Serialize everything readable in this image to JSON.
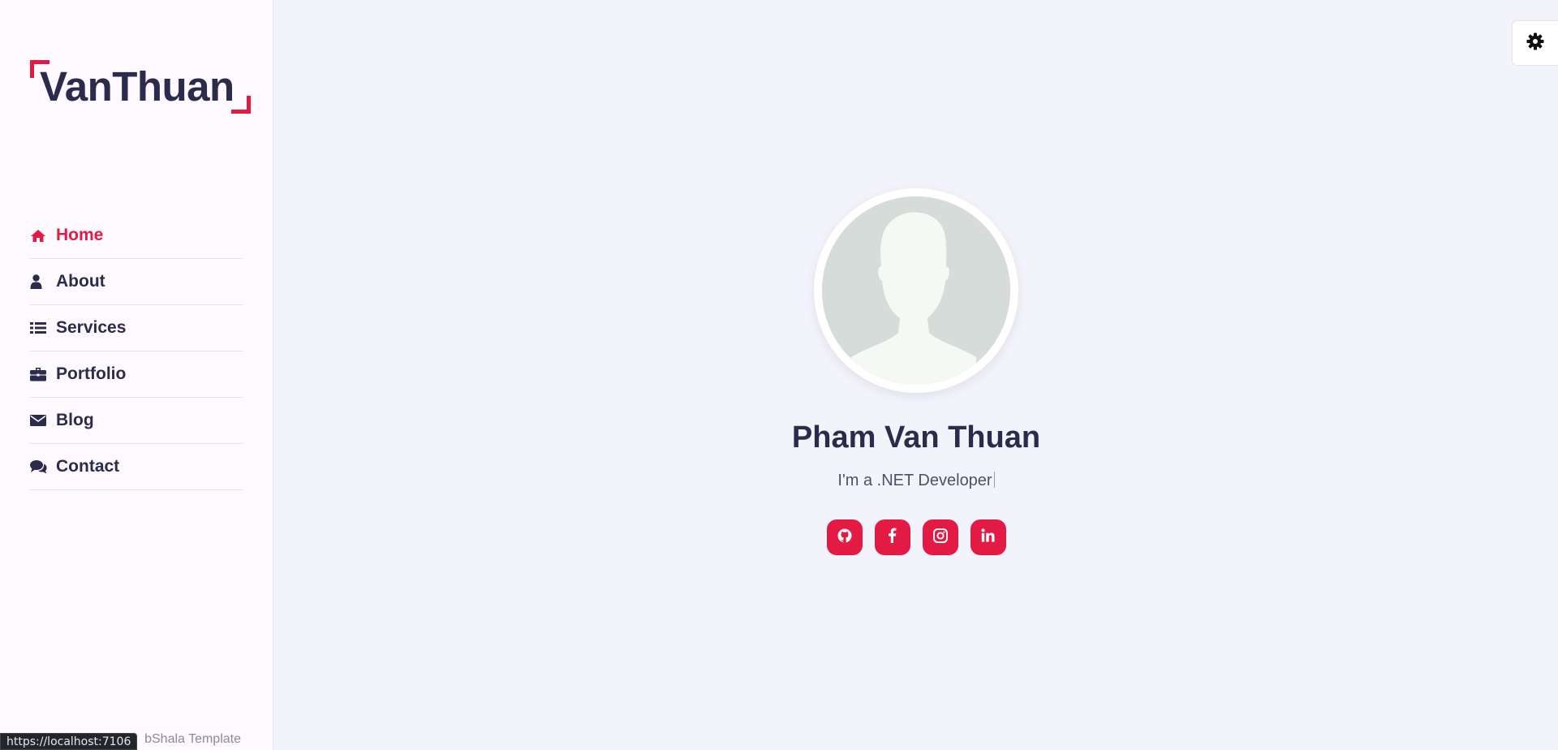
{
  "brand": {
    "logo_text": "VanThuan",
    "accent_color": "#e31b44"
  },
  "nav": {
    "items": [
      {
        "label": "Home",
        "icon": "home-icon",
        "active": true
      },
      {
        "label": "About",
        "icon": "user-icon",
        "active": false
      },
      {
        "label": "Services",
        "icon": "list-icon",
        "active": false
      },
      {
        "label": "Portfolio",
        "icon": "briefcase-icon",
        "active": false
      },
      {
        "label": "Blog",
        "icon": "envelope-icon",
        "active": false
      },
      {
        "label": "Contact",
        "icon": "comments-icon",
        "active": false
      }
    ]
  },
  "sidebar": {
    "footer_text": "bShala Template"
  },
  "status_bar": {
    "url": "https://localhost:7106"
  },
  "settings": {
    "icon": "gear-icon"
  },
  "hero": {
    "name": "Pham Van Thuan",
    "role": "I'm a .NET Developer",
    "avatar": "default-avatar-silhouette"
  },
  "socials": [
    {
      "name": "github",
      "icon": "github-icon"
    },
    {
      "name": "facebook",
      "icon": "facebook-icon"
    },
    {
      "name": "instagram",
      "icon": "instagram-icon"
    },
    {
      "name": "linkedin",
      "icon": "linkedin-icon"
    }
  ]
}
